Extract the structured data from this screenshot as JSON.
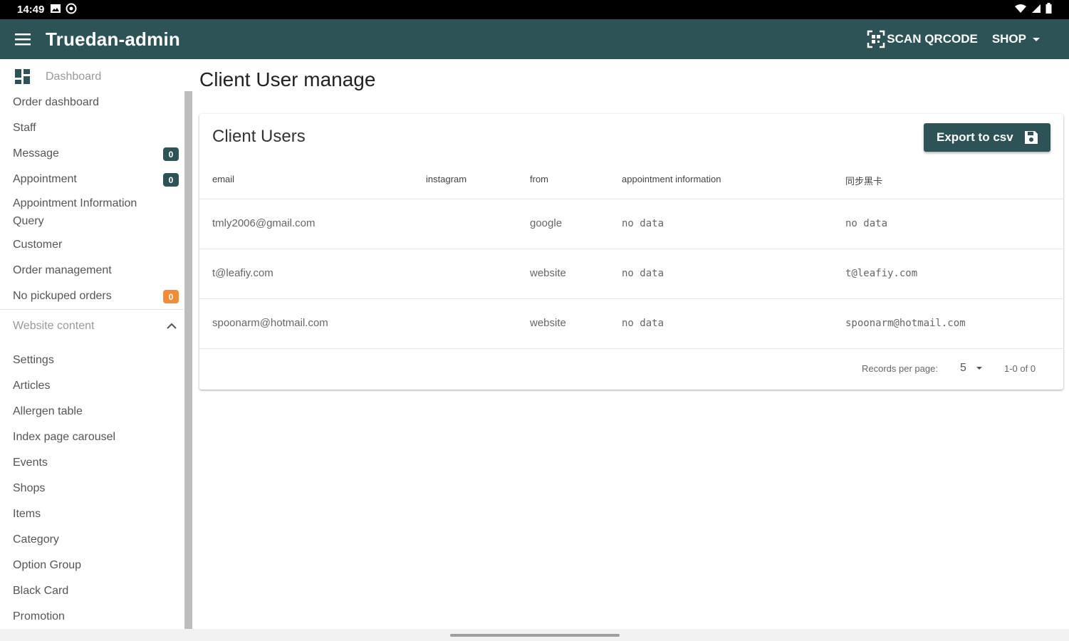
{
  "status_bar": {
    "time": "14:49"
  },
  "app_bar": {
    "title": "Truedan-admin",
    "scan_label": "SCAN QRCODE",
    "shop_label": "SHOP"
  },
  "sidebar": {
    "dashboard": "Dashboard",
    "items": [
      {
        "label": "Order dashboard"
      },
      {
        "label": "Staff"
      },
      {
        "label": "Message",
        "badge": "0"
      },
      {
        "label": "Appointment",
        "badge": "0"
      },
      {
        "label": "Appointment Information Query"
      },
      {
        "label": "Customer"
      },
      {
        "label": "Order management"
      },
      {
        "label": "No pickuped orders",
        "badge": "0"
      }
    ],
    "section_title": "Website content",
    "section_items": [
      "Settings",
      "Articles",
      "Allergen table",
      "Index page carousel",
      "Events",
      "Shops",
      "Items",
      "Category",
      "Option Group",
      "Black Card",
      "Promotion"
    ]
  },
  "page": {
    "title": "Client User manage"
  },
  "card": {
    "title": "Client Users",
    "export_label": "Export to csv",
    "columns": [
      "email",
      "instagram",
      "from",
      "appointment information",
      "同步黑卡"
    ],
    "rows": [
      {
        "email": "tmly2006@gmail.com",
        "instagram": "",
        "from": "google",
        "appointment": "no data",
        "blackcard": "no data"
      },
      {
        "email": "t@leafiy.com",
        "instagram": "",
        "from": "website",
        "appointment": "no data",
        "blackcard": "t@leafiy.com"
      },
      {
        "email": "spoonarm@hotmail.com",
        "instagram": "",
        "from": "website",
        "appointment": "no data",
        "blackcard": "spoonarm@hotmail.com"
      }
    ],
    "footer": {
      "records_label": "Records per page:",
      "per_page": "5",
      "range": "1-0 of 0"
    }
  },
  "colors": {
    "primary": "#2d5357",
    "badge_dark": "#2d5357",
    "badge_orange": "#f28c38"
  }
}
